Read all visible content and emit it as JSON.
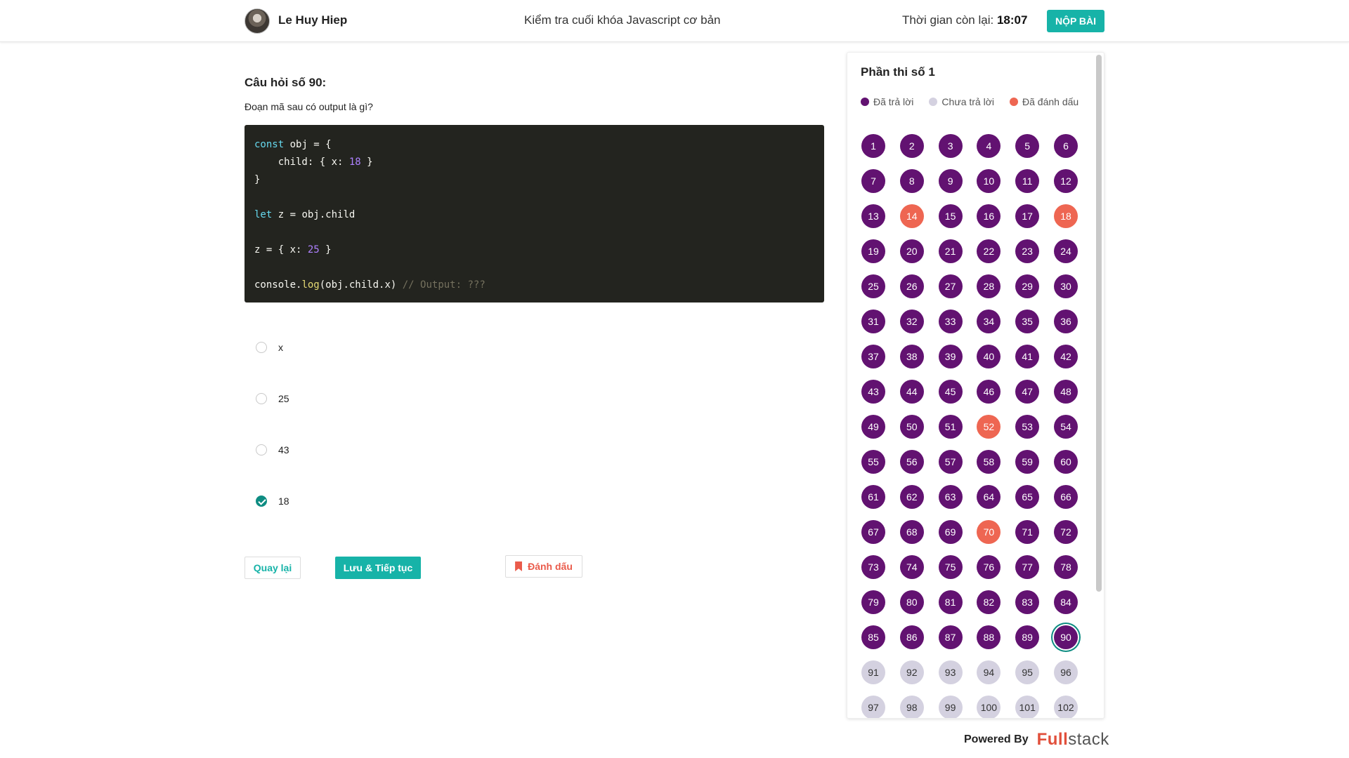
{
  "header": {
    "user_name": "Le Huy Hiep",
    "exam_title": "Kiểm tra cuối khóa Javascript cơ bản",
    "timer_label": "Thời gian còn lại:",
    "timer_value": "18:07",
    "submit_label": "NỘP BÀI"
  },
  "question": {
    "title": "Câu hỏi số 90:",
    "text": "Đoạn mã sau có output là gì?",
    "code_lines": [
      "const obj = {",
      "    child: { x: 18 }",
      "}",
      "",
      "let z = obj.child",
      "",
      "z = { x: 25 }",
      "",
      "console.log(obj.child.x) // Output: ???"
    ],
    "options": [
      {
        "label": "x",
        "checked": false
      },
      {
        "label": "25",
        "checked": false
      },
      {
        "label": "43",
        "checked": false
      },
      {
        "label": "18",
        "checked": true
      }
    ]
  },
  "actions": {
    "back_label": "Quay lại",
    "save_label": "Lưu & Tiếp tục",
    "flag_label": "Đánh dấu"
  },
  "panel": {
    "title": "Phần thi số 1",
    "legend": {
      "answered": "Đã trả lời",
      "unanswered": "Chưa trả lời",
      "flagged": "Đã đánh dấu"
    },
    "current_question": 90,
    "flagged_questions": [
      14,
      18,
      52,
      70
    ],
    "answered_up_to": 90,
    "visible_questions": 102
  },
  "colors": {
    "accent": "#17b3a8",
    "answered": "#621271",
    "flagged": "#ee6652",
    "unanswered": "#d4d1e0",
    "current_ring": "#0e8c82"
  },
  "footer": {
    "powered_by": "Powered By",
    "logo_full": "Full",
    "logo_stack": "stack"
  }
}
